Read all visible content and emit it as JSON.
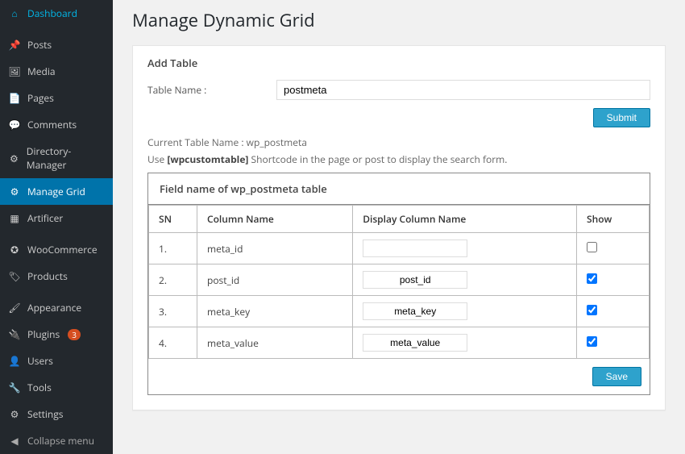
{
  "sidebar": {
    "dashboard": "Dashboard",
    "posts": "Posts",
    "media": "Media",
    "pages": "Pages",
    "comments": "Comments",
    "directory_manager": "Directory-Manager",
    "manage_grid": "Manage Grid",
    "artificer": "Artificer",
    "woocommerce": "WooCommerce",
    "products": "Products",
    "appearance": "Appearance",
    "plugins": "Plugins",
    "plugins_badge": "3",
    "users": "Users",
    "tools": "Tools",
    "settings": "Settings",
    "collapse": "Collapse menu"
  },
  "main": {
    "title": "Manage Dynamic Grid",
    "add_table_heading": "Add Table",
    "table_name_label": "Table Name :",
    "table_name_value": "postmeta",
    "submit_label": "Submit",
    "current_table_label": "Current Table Name :",
    "current_table_name": "wp_postmeta",
    "use_prefix": "Use",
    "shortcode": "[wpcustomtable]",
    "use_suffix": "Shortcode in the page or post to display the search form.",
    "grid_heading": "Field name of wp_postmeta table",
    "cols": {
      "sn": "SN",
      "column_name": "Column Name",
      "display_name": "Display Column Name",
      "show": "Show"
    },
    "rows": [
      {
        "sn": "1.",
        "column_name": "meta_id",
        "display_value": "",
        "show": false
      },
      {
        "sn": "2.",
        "column_name": "post_id",
        "display_value": "post_id",
        "show": true
      },
      {
        "sn": "3.",
        "column_name": "meta_key",
        "display_value": "meta_key",
        "show": true
      },
      {
        "sn": "4.",
        "column_name": "meta_value",
        "display_value": "meta_value",
        "show": true
      }
    ],
    "save_label": "Save"
  }
}
